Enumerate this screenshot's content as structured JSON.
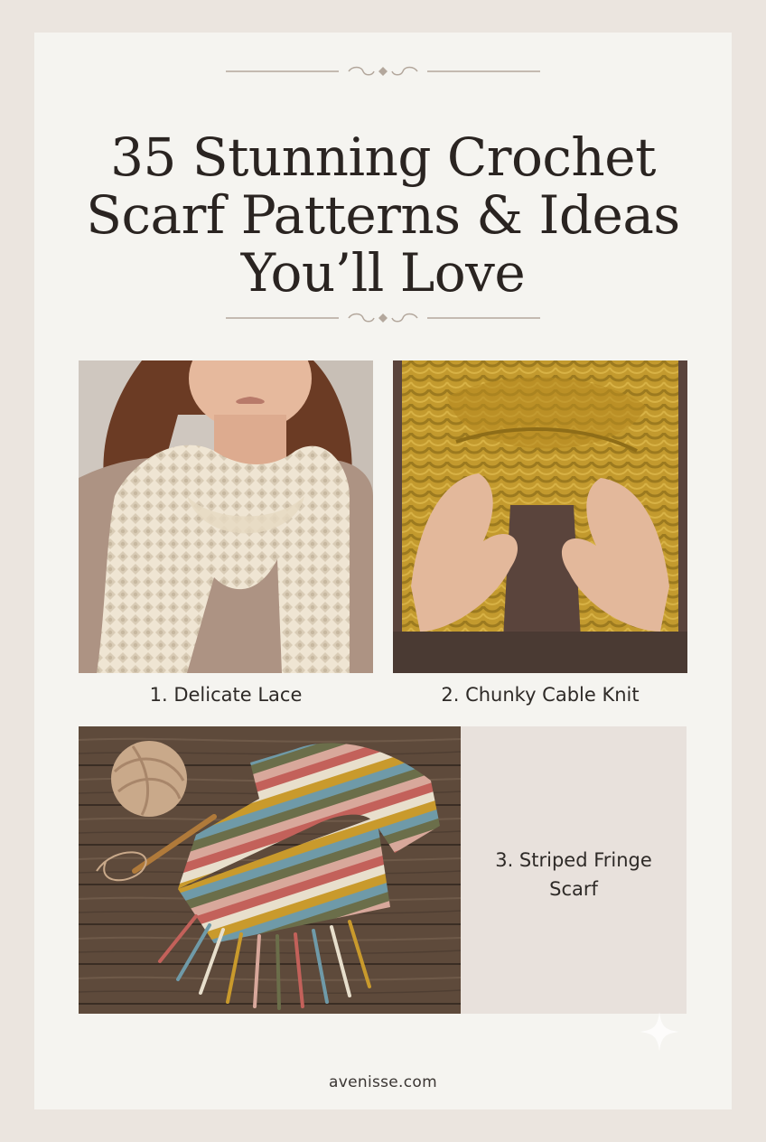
{
  "title_lines": [
    "35 Stunning Crochet",
    "Scarf Patterns & Ideas",
    "You’ll Love"
  ],
  "items": [
    {
      "caption": "1. Delicate Lace"
    },
    {
      "caption": "2. Chunky Cable Knit"
    },
    {
      "caption_lines": [
        "3. Striped Fringe",
        "Scarf"
      ]
    }
  ],
  "footer": "avenisse.com",
  "colors": {
    "background": "#ebe5df",
    "card": "#f5f4f0",
    "panel": "#e8e1dc",
    "text": "#2a2421",
    "ornament": "#b3a79c"
  },
  "icons": [
    "divider-flourish-icon",
    "sparkle-icon"
  ]
}
